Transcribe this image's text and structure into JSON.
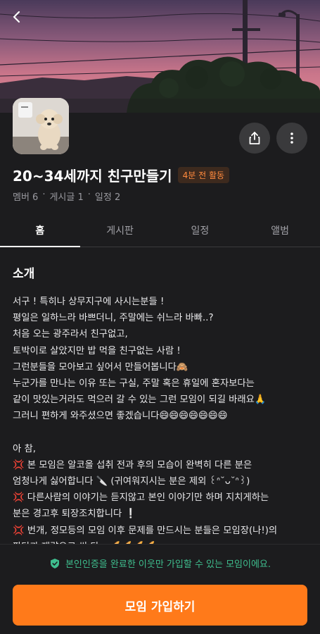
{
  "header": {
    "back_icon": "chevron-left-icon",
    "share_icon": "share-icon",
    "more_icon": "more-vertical-icon"
  },
  "group": {
    "title": "20~34세까지 친구만들기",
    "activity_badge": "4분 전 활동",
    "meta": {
      "members": "멤버 6",
      "posts": "게시글 1",
      "schedules": "일정 2",
      "separator": "·"
    }
  },
  "tabs": [
    {
      "label": "홈",
      "active": true
    },
    {
      "label": "게시판",
      "active": false
    },
    {
      "label": "일정",
      "active": false
    },
    {
      "label": "앨범",
      "active": false
    }
  ],
  "intro": {
    "title": "소개",
    "lines": [
      "서구 ! 특히나 상무지구에 사시는분들 !",
      "평일은 일하느라 바쁘더니, 주말에는 쉬느라 바빠..?",
      "처음 오는 광주라서 친구없고,",
      "토박이로 살았지만 밥 먹을 친구없는 사람 !",
      "그런분들을 모아보고 싶어서 만들어봅니다🙈",
      "누군가를 만나는 이유 또는 구실, 주말 혹은 휴일에 혼자보다는",
      "같이 맛있는거라도 먹으러 갈 수 있는 그런 모임이 되길 바래요🙏",
      "그러니 편하게 와주셨으면 좋겠습니다😄😄😄😄😄😄😄",
      "",
      "아 참,",
      "💢 본 모임은 알코올 섭취 전과 후의 모습이 완벽히 다른 분은",
      "엄청나게 싫어합니다 🔪 (귀여워지시는 분은 제외 ꒰ᐢ˘ᴗ˘ᐢ꒱)",
      "💢 다른사람의 이야기는 듣지않고 본인 이야기만 하며 지치게하는",
      "분은 경고후 퇴장조치합니다 ❕",
      "💢 번개, 정모등의 모임 이후 문제를 만드시는 분들은 모임장(나!)의",
      "판단과 재량으로 싹 다 - 🥖🥖🥖🥖"
    ]
  },
  "footer": {
    "notice": "본인인증을 완료한 이웃만 가입할 수 있는 모임이에요.",
    "notice_icon": "shield-check-icon",
    "join_label": "모임 가입하기"
  },
  "colors": {
    "accent": "#ff7a1a",
    "badge_text": "#ff8a3d",
    "verified": "#3fbf8f",
    "background": "#1c1c1e"
  }
}
